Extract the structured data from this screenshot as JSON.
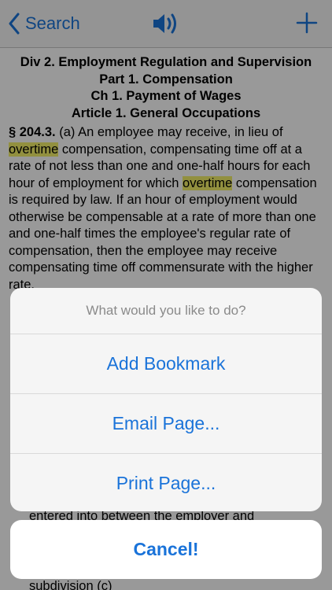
{
  "navbar": {
    "back_label": "Search",
    "speaker_icon": "speaker-wave-icon",
    "add_icon": "plus-icon"
  },
  "document": {
    "headings": [
      "Div 2. Employment Regulation and Supervision",
      "Part 1. Compensation",
      "Ch 1. Payment of Wages",
      "Article 1. General Occupations"
    ],
    "section_number": "§ 204.3.",
    "highlight_term": "overtime",
    "paragraph_parts": [
      " (a) An employee may receive, in lieu of ",
      "overtime",
      " compensation, compensating time off at a rate of not less than one and one-half hours for each hour of employment for which ",
      "overtime",
      " compensation is required by law. If an hour of employment would otherwise be compensable at a rate of more than one and one-half times the employee's regular rate of compensation, then the employee may receive compensating time off commensurate with the higher rate."
    ],
    "partial_line_1": "entered into between the employer and",
    "partial_line_2": "subdivision (c)"
  },
  "action_sheet": {
    "title": "What would you like to do?",
    "options": [
      "Add Bookmark",
      "Email Page...",
      "Print Page..."
    ],
    "cancel_label": "Cancel!"
  },
  "colors": {
    "accent": "#1a73d9",
    "highlight": "#f3f06a",
    "overlay": "rgba(0,0,0,0.40)"
  }
}
